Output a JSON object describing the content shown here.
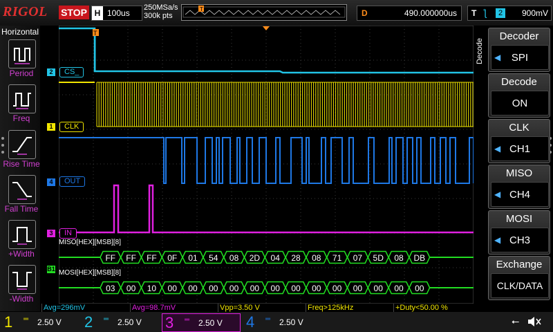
{
  "brand": "RIGOL",
  "run_state": "STOP",
  "timebase": {
    "key": "H",
    "value": "100us"
  },
  "sample": {
    "rate": "250MSa/s",
    "points": "300k pts"
  },
  "delay": {
    "key": "D",
    "value": "490.000000us"
  },
  "trigger": {
    "key": "T",
    "source": "2",
    "level": "900mV"
  },
  "left_menu": {
    "title": "Horizontal",
    "items": [
      "Period",
      "Freq",
      "Rise Time",
      "Fall Time",
      "+Width",
      "-Width"
    ]
  },
  "right_menu": {
    "side_label": "Decode",
    "items": [
      {
        "title": "Decoder",
        "value": "SPI"
      },
      {
        "title": "Decode",
        "value": "ON"
      },
      {
        "title": "CLK",
        "value": "CH1"
      },
      {
        "title": "MISO",
        "value": "CH4"
      },
      {
        "title": "MOSI",
        "value": "CH3"
      },
      {
        "title": "Exchange",
        "value": "CLK/DATA"
      }
    ]
  },
  "channels": {
    "cs": {
      "num": "2",
      "label": "CS_"
    },
    "clk": {
      "num": "1",
      "label": "CLK"
    },
    "out": {
      "num": "4",
      "label": "OUT"
    },
    "in": {
      "num": "3",
      "label": "IN"
    },
    "bus_marker": "B1"
  },
  "decode": {
    "miso_title": "MISO[HEX][MSB][8]",
    "miso": [
      "FF",
      "FF",
      "FF",
      "0F",
      "01",
      "54",
      "08",
      "2D",
      "04",
      "28",
      "08",
      "71",
      "07",
      "5D",
      "08",
      "DB"
    ],
    "mosi_title": "MOSI[HEX][MSB][8]",
    "mosi": [
      "03",
      "00",
      "10",
      "00",
      "00",
      "00",
      "00",
      "00",
      "00",
      "00",
      "00",
      "00",
      "00",
      "00",
      "00",
      "00"
    ]
  },
  "measurements": [
    "Avg=296mV",
    "Avg=98.7mV",
    "Vpp=3.50 V",
    "Freq>125kHz",
    "+Duty<50.00 %"
  ],
  "bottom": [
    {
      "num": "1",
      "scale": "2.50 V"
    },
    {
      "num": "2",
      "scale": "2.50 V"
    },
    {
      "num": "3",
      "scale": "2.50 V"
    },
    {
      "num": "4",
      "scale": "2.50 V"
    }
  ],
  "colors": {
    "ch1": "#f2e600",
    "ch2": "#22c4e6",
    "ch3": "#e020e0",
    "ch4": "#1e78e6",
    "decode": "#22dd22",
    "accent": "#ff8c1a"
  },
  "icons": [
    "usb-icon",
    "speaker-mute-icon"
  ]
}
